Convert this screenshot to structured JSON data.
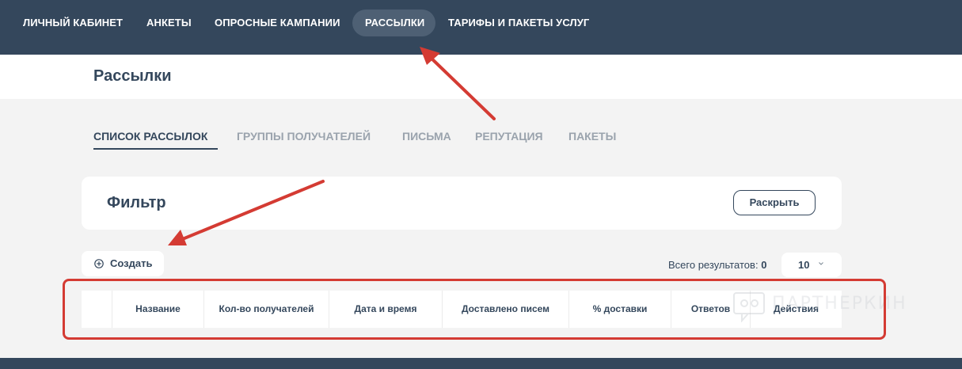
{
  "topnav": {
    "items": [
      {
        "label": "ЛИЧНЫЙ КАБИНЕТ"
      },
      {
        "label": "АНКЕТЫ"
      },
      {
        "label": "ОПРОСНЫЕ КАМПАНИИ"
      },
      {
        "label": "РАССЫЛКИ",
        "active": true
      },
      {
        "label": "ТАРИФЫ И ПАКЕТЫ УСЛУГ"
      }
    ]
  },
  "page": {
    "title": "Рассылки"
  },
  "tabs": [
    {
      "label": "СПИСОК РАССЫЛОК",
      "active": true
    },
    {
      "label": "ГРУППЫ ПОЛУЧАТЕЛЕЙ"
    },
    {
      "label": "ПИСЬМА"
    },
    {
      "label": "РЕПУТАЦИЯ"
    },
    {
      "label": "ПАКЕТЫ"
    }
  ],
  "filter": {
    "title": "Фильтр",
    "expand_label": "Раскрыть"
  },
  "toolbar": {
    "create_label": "Создать",
    "results_label": "Всего результатов:",
    "results_count": "0",
    "page_size": "10"
  },
  "table": {
    "columns": [
      "",
      "Название",
      "Кол-во получателей",
      "Дата и время",
      "Доставлено писем",
      "% доставки",
      "Ответов",
      "Действия"
    ]
  },
  "watermark": {
    "text": "ПАРТНЕРКИН"
  },
  "colors": {
    "nav_bg": "#34475c",
    "accent": "#34475c",
    "annotation_red": "#d43b33"
  }
}
